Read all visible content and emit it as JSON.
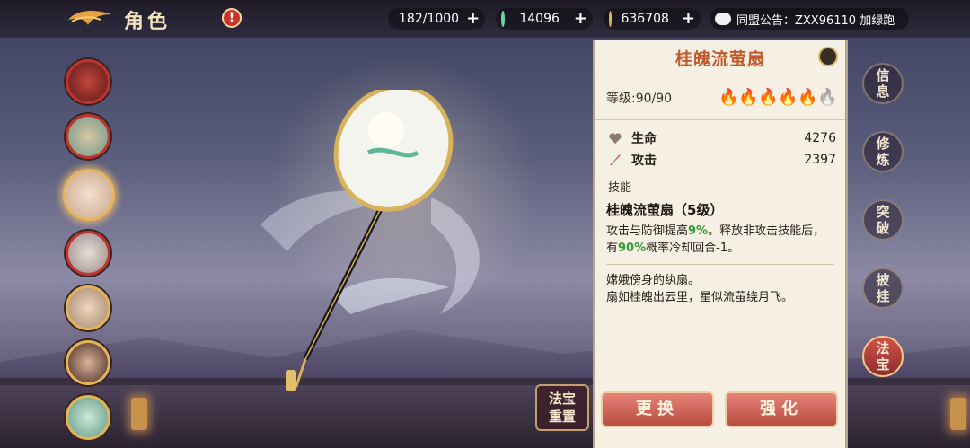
{
  "header": {
    "title": "角色",
    "alert": "!"
  },
  "resources": [
    {
      "name": "peach",
      "value": "182/1000",
      "color": "#f19c7d"
    },
    {
      "name": "jade",
      "value": "14096",
      "color": "#6fd0a0"
    },
    {
      "name": "coin",
      "value": "636708",
      "color": "#e0b35e"
    }
  ],
  "notice": {
    "text": "同盟公告：ZXX96110  加绿跑"
  },
  "item": {
    "name": "桂魄流萤扇",
    "level": "等级:90/90",
    "stars_lit": 5,
    "stars_total": 6,
    "stats": [
      {
        "label": "生命",
        "value": "4276"
      },
      {
        "label": "攻击",
        "value": "2397"
      }
    ],
    "skill_section": "技能",
    "skill_name": "桂魄流萤扇（5级）",
    "skill_desc_1": "攻击与防御提高",
    "skill_hl_1": "9%",
    "skill_desc_2": "。释放非攻击技能后，有",
    "skill_hl_2": "90%",
    "skill_desc_3": "概率冷却回合-1。",
    "lore_1": "嫦娥傍身的纨扇。",
    "lore_2": "扇如桂魄出云里，星似流萤绕月飞。"
  },
  "buttons": {
    "replace": "更换",
    "enhance": "强化",
    "reset_1": "法宝",
    "reset_2": "重置"
  },
  "tabs": [
    {
      "l1": "信",
      "l2": "息"
    },
    {
      "l1": "修",
      "l2": "炼"
    },
    {
      "l1": "突",
      "l2": "破"
    },
    {
      "l1": "披",
      "l2": "挂"
    },
    {
      "l1": "法",
      "l2": "宝"
    }
  ],
  "active_tab": 4
}
